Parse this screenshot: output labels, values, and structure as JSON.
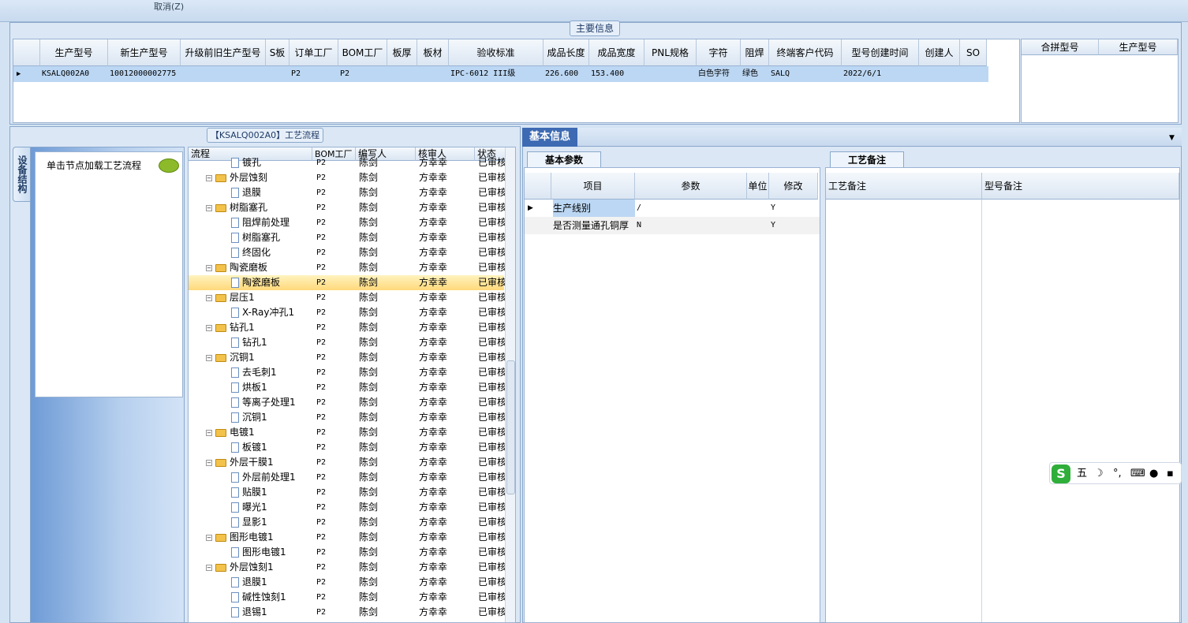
{
  "topstrip": {
    "cancel_label": "取消(Z)"
  },
  "main_info": {
    "title": "主要信息",
    "columns": [
      "生产型号",
      "新生产型号",
      "升级前旧生产型号",
      "S板",
      "订单工厂",
      "BOM工厂",
      "板厚",
      "板材",
      "验收标准",
      "成品长度",
      "成品宽度",
      "PNL规格",
      "字符",
      "阻焊",
      "终端客户代码",
      "型号创建时间",
      "创建人",
      "SO"
    ],
    "row": [
      "KSALQ002A0",
      "10012000002775",
      "",
      "",
      "P2",
      "P2",
      "",
      "",
      "IPC-6012 III级",
      "226.600",
      "153.400",
      "",
      "白色字符",
      "绿色",
      "SALQ",
      "2022/6/1",
      "",
      ""
    ],
    "side_columns": [
      "合拼型号",
      "生产型号"
    ]
  },
  "flow": {
    "title": "【KSALQ002A0】工艺流程",
    "vertical_tab": "设备结构",
    "hint": "单击节点加载工艺流程",
    "columns": [
      "流程",
      "BOM工厂",
      "编写人",
      "核审人",
      "状态"
    ],
    "rows": [
      {
        "name": "镀孔",
        "level": 2,
        "factory": "P2",
        "writer": "陈剑",
        "reviewer": "方幸幸",
        "status": "已审核"
      },
      {
        "name": "外层蚀刻",
        "level": 1,
        "factory": "P2",
        "writer": "陈剑",
        "reviewer": "方幸幸",
        "status": "已审核"
      },
      {
        "name": "退膜",
        "level": 2,
        "factory": "P2",
        "writer": "陈剑",
        "reviewer": "方幸幸",
        "status": "已审核"
      },
      {
        "name": "树脂塞孔",
        "level": 1,
        "factory": "P2",
        "writer": "陈剑",
        "reviewer": "方幸幸",
        "status": "已审核"
      },
      {
        "name": "阻焊前处理",
        "level": 2,
        "factory": "P2",
        "writer": "陈剑",
        "reviewer": "方幸幸",
        "status": "已审核"
      },
      {
        "name": "树脂塞孔",
        "level": 2,
        "factory": "P2",
        "writer": "陈剑",
        "reviewer": "方幸幸",
        "status": "已审核"
      },
      {
        "name": "终固化",
        "level": 2,
        "factory": "P2",
        "writer": "陈剑",
        "reviewer": "方幸幸",
        "status": "已审核"
      },
      {
        "name": "陶瓷磨板",
        "level": 1,
        "factory": "P2",
        "writer": "陈剑",
        "reviewer": "方幸幸",
        "status": "已审核"
      },
      {
        "name": "陶瓷磨板",
        "level": 2,
        "factory": "P2",
        "writer": "陈剑",
        "reviewer": "方幸幸",
        "status": "已审核",
        "selected": true
      },
      {
        "name": "层压1",
        "level": 1,
        "factory": "P2",
        "writer": "陈剑",
        "reviewer": "方幸幸",
        "status": "已审核"
      },
      {
        "name": "X-Ray冲孔1",
        "level": 2,
        "factory": "P2",
        "writer": "陈剑",
        "reviewer": "方幸幸",
        "status": "已审核"
      },
      {
        "name": "钻孔1",
        "level": 1,
        "factory": "P2",
        "writer": "陈剑",
        "reviewer": "方幸幸",
        "status": "已审核"
      },
      {
        "name": "钻孔1",
        "level": 2,
        "factory": "P2",
        "writer": "陈剑",
        "reviewer": "方幸幸",
        "status": "已审核"
      },
      {
        "name": "沉铜1",
        "level": 1,
        "factory": "P2",
        "writer": "陈剑",
        "reviewer": "方幸幸",
        "status": "已审核"
      },
      {
        "name": "去毛刺1",
        "level": 2,
        "factory": "P2",
        "writer": "陈剑",
        "reviewer": "方幸幸",
        "status": "已审核"
      },
      {
        "name": "烘板1",
        "level": 2,
        "factory": "P2",
        "writer": "陈剑",
        "reviewer": "方幸幸",
        "status": "已审核"
      },
      {
        "name": "等离子处理1",
        "level": 2,
        "factory": "P2",
        "writer": "陈剑",
        "reviewer": "方幸幸",
        "status": "已审核"
      },
      {
        "name": "沉铜1",
        "level": 2,
        "factory": "P2",
        "writer": "陈剑",
        "reviewer": "方幸幸",
        "status": "已审核"
      },
      {
        "name": "电镀1",
        "level": 1,
        "factory": "P2",
        "writer": "陈剑",
        "reviewer": "方幸幸",
        "status": "已审核"
      },
      {
        "name": "板镀1",
        "level": 2,
        "factory": "P2",
        "writer": "陈剑",
        "reviewer": "方幸幸",
        "status": "已审核"
      },
      {
        "name": "外层干膜1",
        "level": 1,
        "factory": "P2",
        "writer": "陈剑",
        "reviewer": "方幸幸",
        "status": "已审核"
      },
      {
        "name": "外层前处理1",
        "level": 2,
        "factory": "P2",
        "writer": "陈剑",
        "reviewer": "方幸幸",
        "status": "已审核"
      },
      {
        "name": "贴膜1",
        "level": 2,
        "factory": "P2",
        "writer": "陈剑",
        "reviewer": "方幸幸",
        "status": "已审核"
      },
      {
        "name": "曝光1",
        "level": 2,
        "factory": "P2",
        "writer": "陈剑",
        "reviewer": "方幸幸",
        "status": "已审核"
      },
      {
        "name": "显影1",
        "level": 2,
        "factory": "P2",
        "writer": "陈剑",
        "reviewer": "方幸幸",
        "status": "已审核"
      },
      {
        "name": "图形电镀1",
        "level": 1,
        "factory": "P2",
        "writer": "陈剑",
        "reviewer": "方幸幸",
        "status": "已审核"
      },
      {
        "name": "图形电镀1",
        "level": 2,
        "factory": "P2",
        "writer": "陈剑",
        "reviewer": "方幸幸",
        "status": "已审核"
      },
      {
        "name": "外层蚀刻1",
        "level": 1,
        "factory": "P2",
        "writer": "陈剑",
        "reviewer": "方幸幸",
        "status": "已审核"
      },
      {
        "name": "退膜1",
        "level": 2,
        "factory": "P2",
        "writer": "陈剑",
        "reviewer": "方幸幸",
        "status": "已审核"
      },
      {
        "name": "碱性蚀刻1",
        "level": 2,
        "factory": "P2",
        "writer": "陈剑",
        "reviewer": "方幸幸",
        "status": "已审核"
      },
      {
        "name": "退锡1",
        "level": 2,
        "factory": "P2",
        "writer": "陈剑",
        "reviewer": "方幸幸",
        "status": "已审核"
      }
    ]
  },
  "basic": {
    "tab": "基本信息",
    "subtab": "基本参数",
    "columns": [
      "项目",
      "参数",
      "单位",
      "修改"
    ],
    "rows": [
      {
        "item": "生产线别",
        "param": "/",
        "unit": "",
        "edit": "Y"
      },
      {
        "item": "是否测量通孔铜厚",
        "param": "N",
        "unit": "",
        "edit": "Y"
      }
    ]
  },
  "remarks": {
    "subtab": "工艺备注",
    "columns": [
      "工艺备注",
      "型号备注"
    ]
  },
  "ime": {
    "label": "五"
  }
}
